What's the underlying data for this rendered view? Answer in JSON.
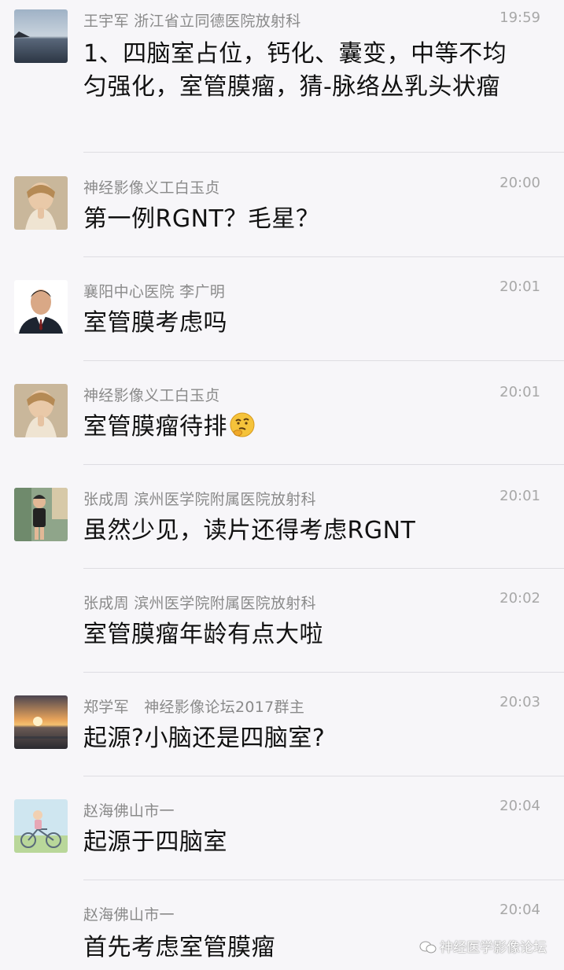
{
  "messages": [
    {
      "sender": "王宇军 浙江省立同德医院放射科",
      "time": "19:59",
      "text": "1、四脑室占位，钙化、囊变，中等不均匀强化，室管膜瘤，猜-脉络丛乳头状瘤",
      "avatar": "lake-avatar"
    },
    {
      "sender": "神经影像义工白玉贞",
      "time": "20:00",
      "text": "第一例RGNT？毛星？",
      "avatar": "child-praying-avatar"
    },
    {
      "sender": "襄阳中心医院 李广明",
      "time": "20:01",
      "text": "室管膜考虑吗",
      "avatar": "man-portrait-avatar"
    },
    {
      "sender": "神经影像义工白玉贞",
      "time": "20:01",
      "text": "室管膜瘤待排",
      "avatar": "child-praying-avatar",
      "emoji": "thinking-emoji"
    },
    {
      "sender": "张成周 滨州医学院附属医院放射科",
      "time": "20:01",
      "text": "虽然少见，读片还得考虑RGNT",
      "avatar": "child-photo-avatar"
    },
    {
      "sender": "张成周 滨州医学院附属医院放射科",
      "time": "20:02",
      "text": "室管膜瘤年龄有点大啦",
      "avatar": ""
    },
    {
      "sender": "郑学军　神经影像论坛2017群主",
      "time": "20:03",
      "text": "起源?小脑还是四脑室?",
      "avatar": "sunset-avatar"
    },
    {
      "sender": "赵海佛山市一",
      "time": "20:04",
      "text": "起源于四脑室",
      "avatar": "bicycle-avatar"
    },
    {
      "sender": "赵海佛山市一",
      "time": "20:04",
      "text": "首先考虑室管膜瘤",
      "avatar": ""
    }
  ],
  "watermark": "神经医学影像论坛"
}
